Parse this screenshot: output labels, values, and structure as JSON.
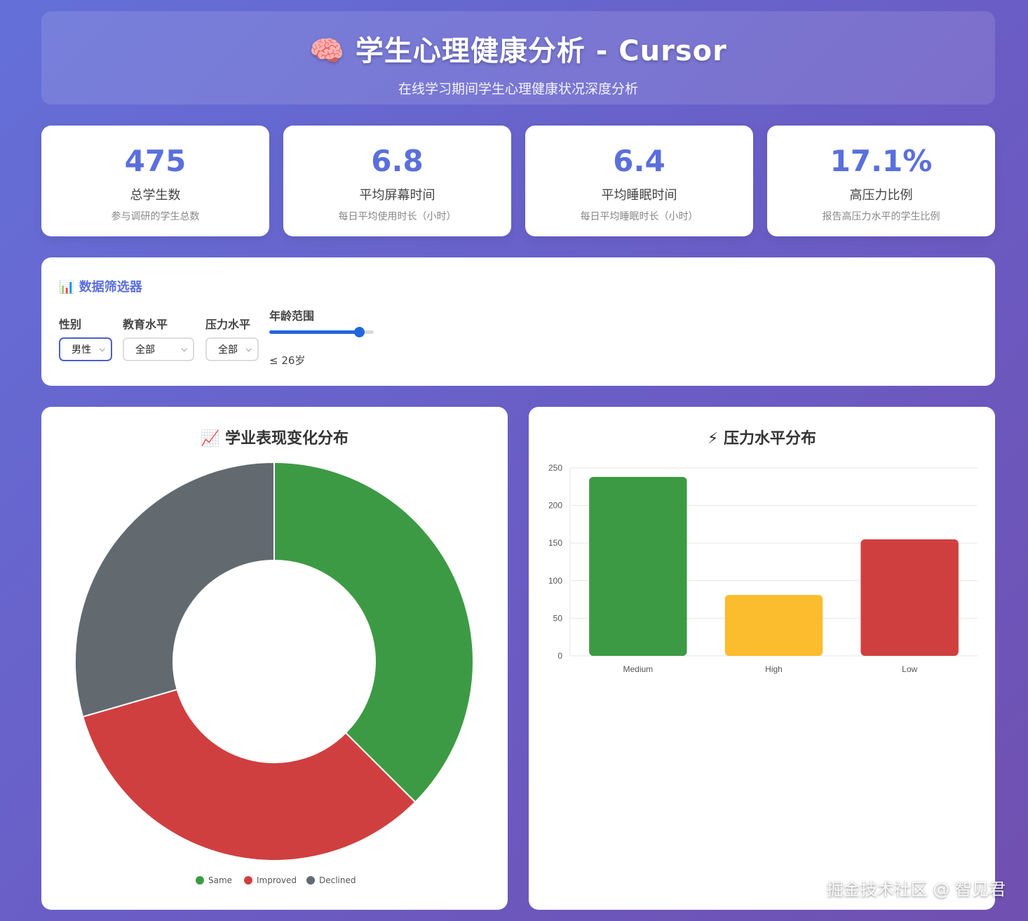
{
  "header": {
    "icon": "brain-icon",
    "icon_glyph": "🧠",
    "title": "学生心理健康分析 - Cursor",
    "subtitle": "在线学习期间学生心理健康状况深度分析"
  },
  "stats": [
    {
      "value": "475",
      "label": "总学生数",
      "desc": "参与调研的学生总数"
    },
    {
      "value": "6.8",
      "label": "平均屏幕时间",
      "desc": "每日平均使用时长（小时）"
    },
    {
      "value": "6.4",
      "label": "平均睡眠时间",
      "desc": "每日平均睡眠时长（小时）"
    },
    {
      "value": "17.1%",
      "label": "高压力比例",
      "desc": "报告高压力水平的学生比例"
    }
  ],
  "filters": {
    "icon": "bar-chart-icon",
    "icon_glyph": "📊",
    "title": "数据筛选器",
    "gender": {
      "label": "性别",
      "value": "男性"
    },
    "education": {
      "label": "教育水平",
      "value": "全部"
    },
    "stress": {
      "label": "压力水平",
      "value": "全部"
    },
    "age": {
      "label": "年龄范围",
      "value_text": "≤ 26岁",
      "slider_fraction": 0.86
    }
  },
  "charts": {
    "donut_title": "学业表现变化分布",
    "donut_icon_glyph": "📈",
    "bar_title": "压力水平分布",
    "bar_icon_glyph": "⚡"
  },
  "chart_data": [
    {
      "type": "pie",
      "variant": "doughnut",
      "title": "学业表现变化分布",
      "categories": [
        "Same",
        "Improved",
        "Declined"
      ],
      "values": [
        178,
        157,
        140
      ],
      "colors": [
        "#3d9a44",
        "#d03f3f",
        "#626a70"
      ],
      "legend": "bottom"
    },
    {
      "type": "bar",
      "title": "压力水平分布",
      "categories": [
        "Medium",
        "High",
        "Low"
      ],
      "values": [
        238,
        81,
        155
      ],
      "colors": [
        "#3d9a44",
        "#fbbc2e",
        "#d03f3f"
      ],
      "ylim": [
        0,
        250
      ],
      "yticks": [
        "0",
        "50",
        "100",
        "150",
        "200",
        "250"
      ],
      "grid": true
    }
  ],
  "watermark": "掘金技术社区 @ 智见君"
}
